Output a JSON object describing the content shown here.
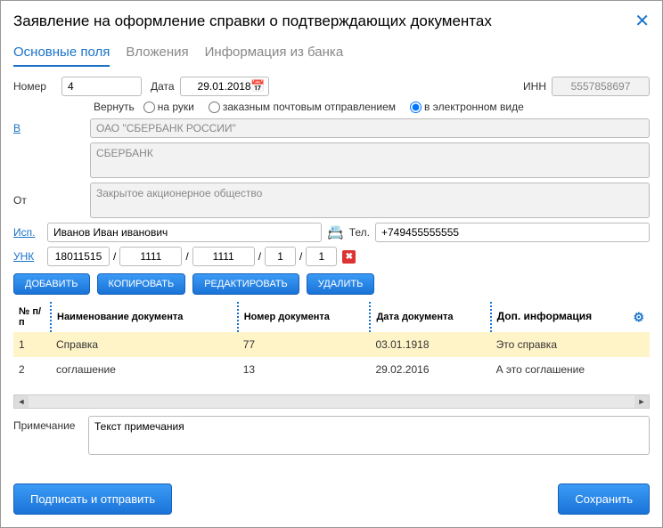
{
  "title": "Заявление на оформление справки о подтверждающих документах",
  "tabs": [
    "Основные поля",
    "Вложения",
    "Информация из банка"
  ],
  "labels": {
    "number": "Номер",
    "date": "Дата",
    "inn": "ИНН",
    "return": "Вернуть",
    "v": "В",
    "ot": "От",
    "isp": "Исп.",
    "tel": "Тел.",
    "unk": "УНК",
    "note": "Примечание"
  },
  "fields": {
    "number": "4",
    "date": "29.01.2018",
    "inn": "5557858697",
    "to": "ОАО \"СБЕРБАНК РОССИИ\"",
    "to2": "СБЕРБАНК",
    "from": "Закрытое акционерное общество",
    "isp": "Иванов Иван иванович",
    "tel": "+749455555555",
    "unk": [
      "18011515",
      "1111",
      "1111",
      "1",
      "1"
    ],
    "note": "Текст примечания"
  },
  "radio": {
    "opt1": "на руки",
    "opt2": "заказным почтовым отправлением",
    "opt3": "в электронном виде"
  },
  "btns": {
    "add": "ДОБАВИТЬ",
    "copy": "КОПИРОВАТЬ",
    "edit": "РЕДАКТИРОВАТЬ",
    "del": "УДАЛИТЬ",
    "sign": "Подписать и отправить",
    "save": "Сохранить"
  },
  "cols": {
    "n": "№ п/п",
    "name": "Наименование документа",
    "num": "Номер документа",
    "dt": "Дата документа",
    "info": "Доп. информация"
  },
  "rows": [
    {
      "n": "1",
      "name": "Справка",
      "num": "77",
      "dt": "03.01.1918",
      "info": "Это справка"
    },
    {
      "n": "2",
      "name": "соглашение",
      "num": "13",
      "dt": "29.02.2016",
      "info": "А это соглашение"
    }
  ]
}
